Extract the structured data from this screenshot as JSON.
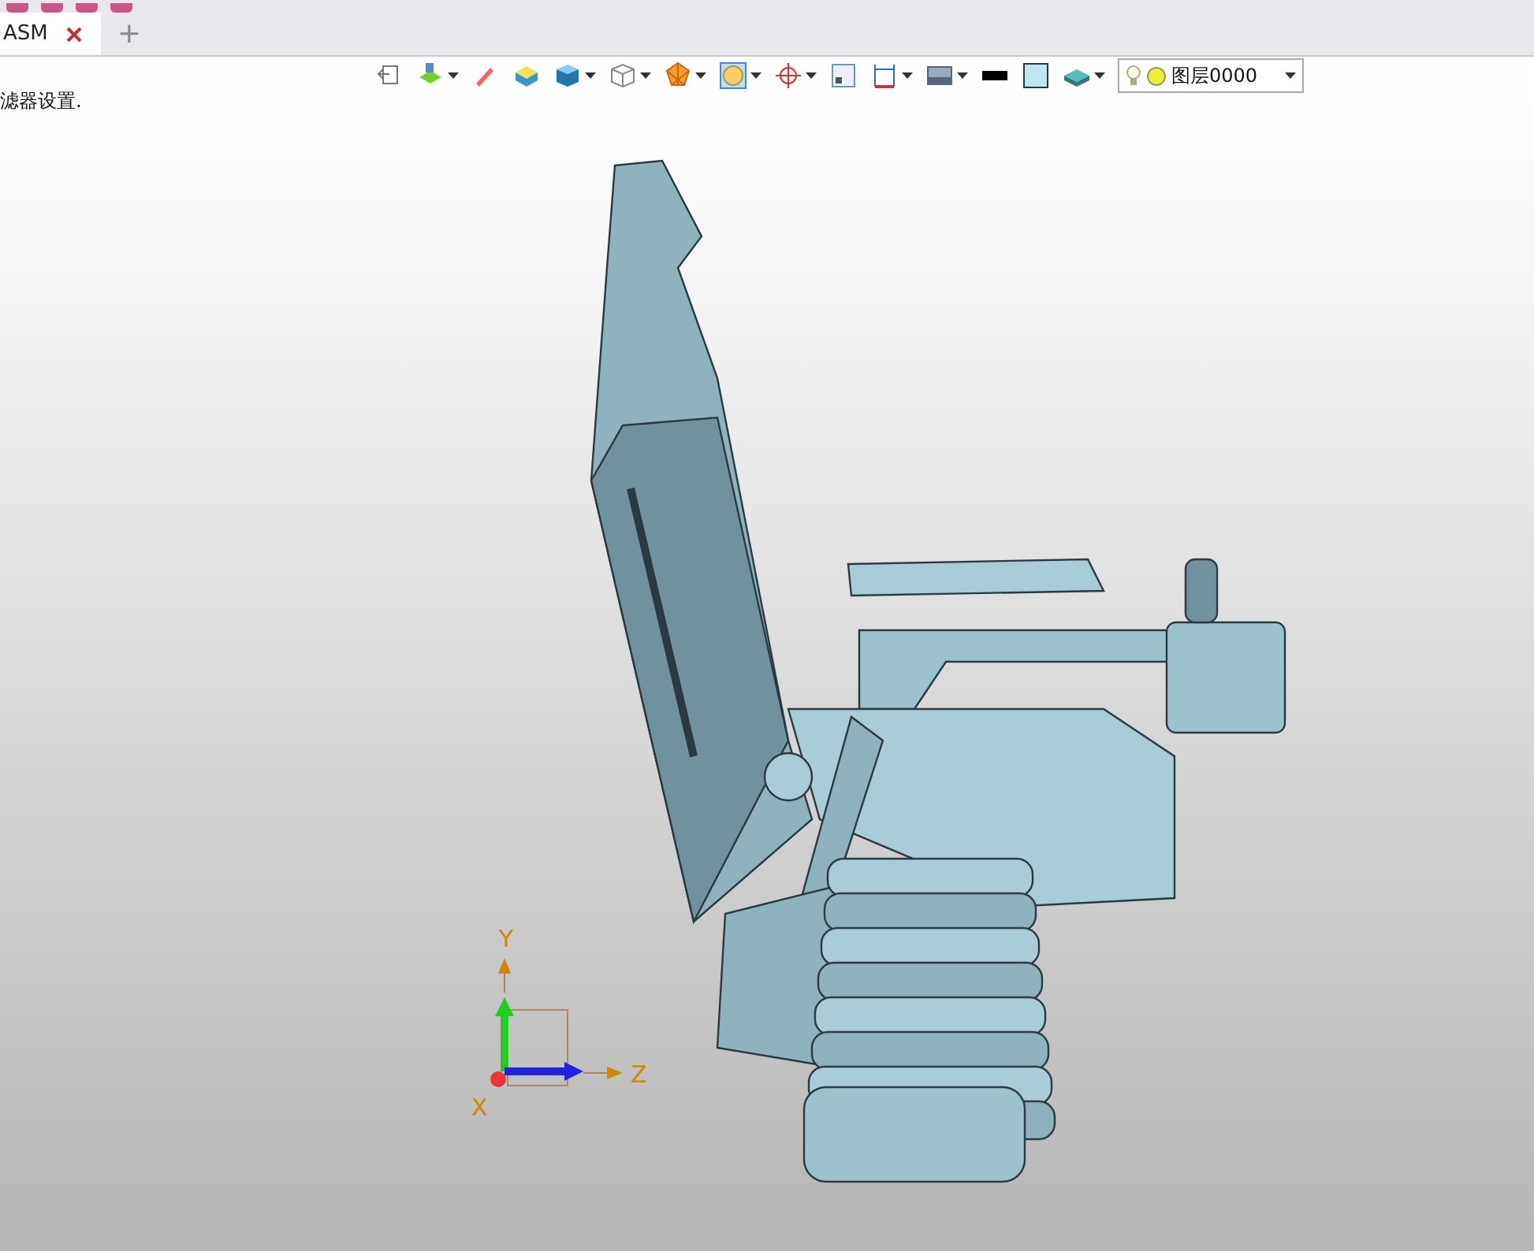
{
  "tab_bar": {
    "tabs": [
      {
        "label": "ASM",
        "selected": true
      }
    ],
    "new_tab": "+"
  },
  "toolbar": {
    "buttons": [
      {
        "dropdown": false
      },
      {
        "dropdown": true
      },
      {
        "dropdown": false
      },
      {
        "dropdown": false
      },
      {
        "dropdown": true
      },
      {
        "dropdown": true
      },
      {
        "dropdown": true
      },
      {
        "dropdown": true
      },
      {
        "dropdown": true
      },
      {
        "dropdown": false
      },
      {
        "dropdown": true
      },
      {
        "dropdown": true
      },
      {
        "dropdown": false
      },
      {
        "dropdown": false
      },
      {
        "dropdown": true
      }
    ],
    "layer_select": {
      "value": "图层0000"
    }
  },
  "status_message": "滤器设置.",
  "triad": {
    "x_label": "X",
    "y_label": "Y",
    "z_label": "Z"
  }
}
